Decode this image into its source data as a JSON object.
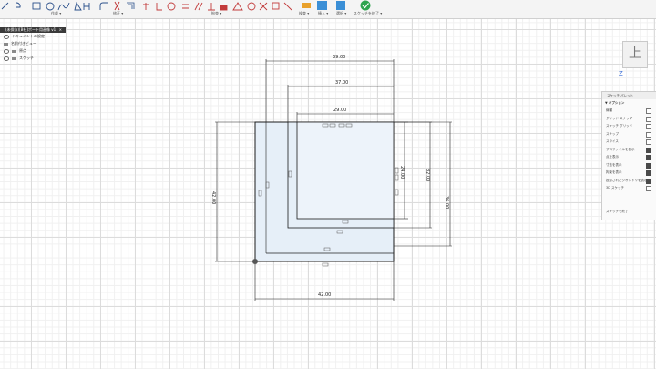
{
  "toolbar": {
    "groups": [
      {
        "id": "create",
        "label": "作成 ▾"
      },
      {
        "id": "modify",
        "label": "修正 ▾"
      },
      {
        "id": "constraints",
        "label": "拘束 ▾"
      },
      {
        "id": "inspect",
        "label": "検査 ▾"
      },
      {
        "id": "insert",
        "label": "挿入 ▾"
      },
      {
        "id": "select",
        "label": "選択 ▾"
      },
      {
        "id": "finish",
        "label": "スケッチを終了 ▾"
      }
    ]
  },
  "browser": {
    "title": "(未保存)[B社]ポート用画像 v1",
    "items": [
      {
        "label": "ドキュメントの設定"
      },
      {
        "label": "名前付きビュー"
      },
      {
        "label": "原点"
      },
      {
        "label": "スケッチ"
      }
    ]
  },
  "viewcube": {
    "face": "上",
    "axis": "Z"
  },
  "palette": {
    "title": "スケッチ パレット",
    "section": "▼ オプション",
    "rows": [
      {
        "label": "線種",
        "checked": false
      },
      {
        "label": "グリッド スナップ",
        "checked": false
      },
      {
        "label": "スケッチ グリッド",
        "checked": false
      },
      {
        "label": "スナップ",
        "checked": false
      },
      {
        "label": "スライス",
        "checked": false
      },
      {
        "label": "プロファイルを表示",
        "checked": true
      },
      {
        "label": "点を表示",
        "checked": true
      },
      {
        "label": "寸法を表示",
        "checked": true
      },
      {
        "label": "拘束を表示",
        "checked": true
      },
      {
        "label": "投影されたジオメトリを表示",
        "checked": true
      },
      {
        "label": "3D スケッチ",
        "checked": false
      }
    ],
    "finish_label": "スケッチを終了"
  },
  "dimensions": {
    "d39": "39.00",
    "d37": "37.00",
    "d29": "29.00",
    "d42w": "42.00",
    "d42h": "42.00",
    "d24": "24.00",
    "d32": "32.00",
    "d36": "36.00"
  }
}
